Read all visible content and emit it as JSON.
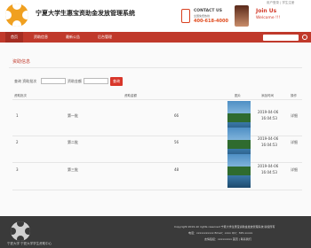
{
  "header": {
    "site_title": "宁夏大学生惠宝资助金发放管理系统",
    "top_links": "用户登录 | 学生注册",
    "contact_label": "CONTACT US",
    "contact_sub": "全国免费热线",
    "phone": "400-618-4000",
    "join_us": "Join Us",
    "welcome": "Welcome !!!"
  },
  "nav": {
    "items": [
      {
        "label": "首页"
      },
      {
        "label": "资助信息"
      },
      {
        "label": "最新公告"
      },
      {
        "label": "后台管理"
      }
    ],
    "active_index": 0
  },
  "main": {
    "section_title": "资助信息",
    "filter": {
      "label1": "查询 资助批次",
      "label2": "资助金额",
      "button": "查询"
    },
    "table": {
      "headers": [
        "资助批次",
        "资助金额",
        "图片",
        "添加时间",
        "操作"
      ],
      "rows": [
        {
          "index": "1",
          "batch": "第一批",
          "amount": "66",
          "date": "2019-04-06",
          "time": "16:04:53",
          "action": "详细"
        },
        {
          "index": "2",
          "batch": "第二批",
          "amount": "56",
          "date": "2019-04-06",
          "time": "16:04:53",
          "action": "详细"
        },
        {
          "index": "3",
          "batch": "第三批",
          "amount": "48",
          "date": "2019-04-06",
          "time": "16:04:53",
          "action": "详细"
        }
      ]
    }
  },
  "footer": {
    "school": "宁夏大学  宁夏大学学生资助中心",
    "copyright": "Copyright 2019 All rights reserved 宁夏大学生惠宝资助金发放管理系统 版权所有",
    "contact": "电话：xxxxxxxxxxx  Email：xxxx   QQ：325-xxxxx",
    "link": "友情链接：xxxxxxxxx  首页  |  联系我们"
  },
  "colors": {
    "brand_red": "#c0392b",
    "accent_orange": "#f0a020",
    "footer_bg": "#3a3a3a"
  }
}
